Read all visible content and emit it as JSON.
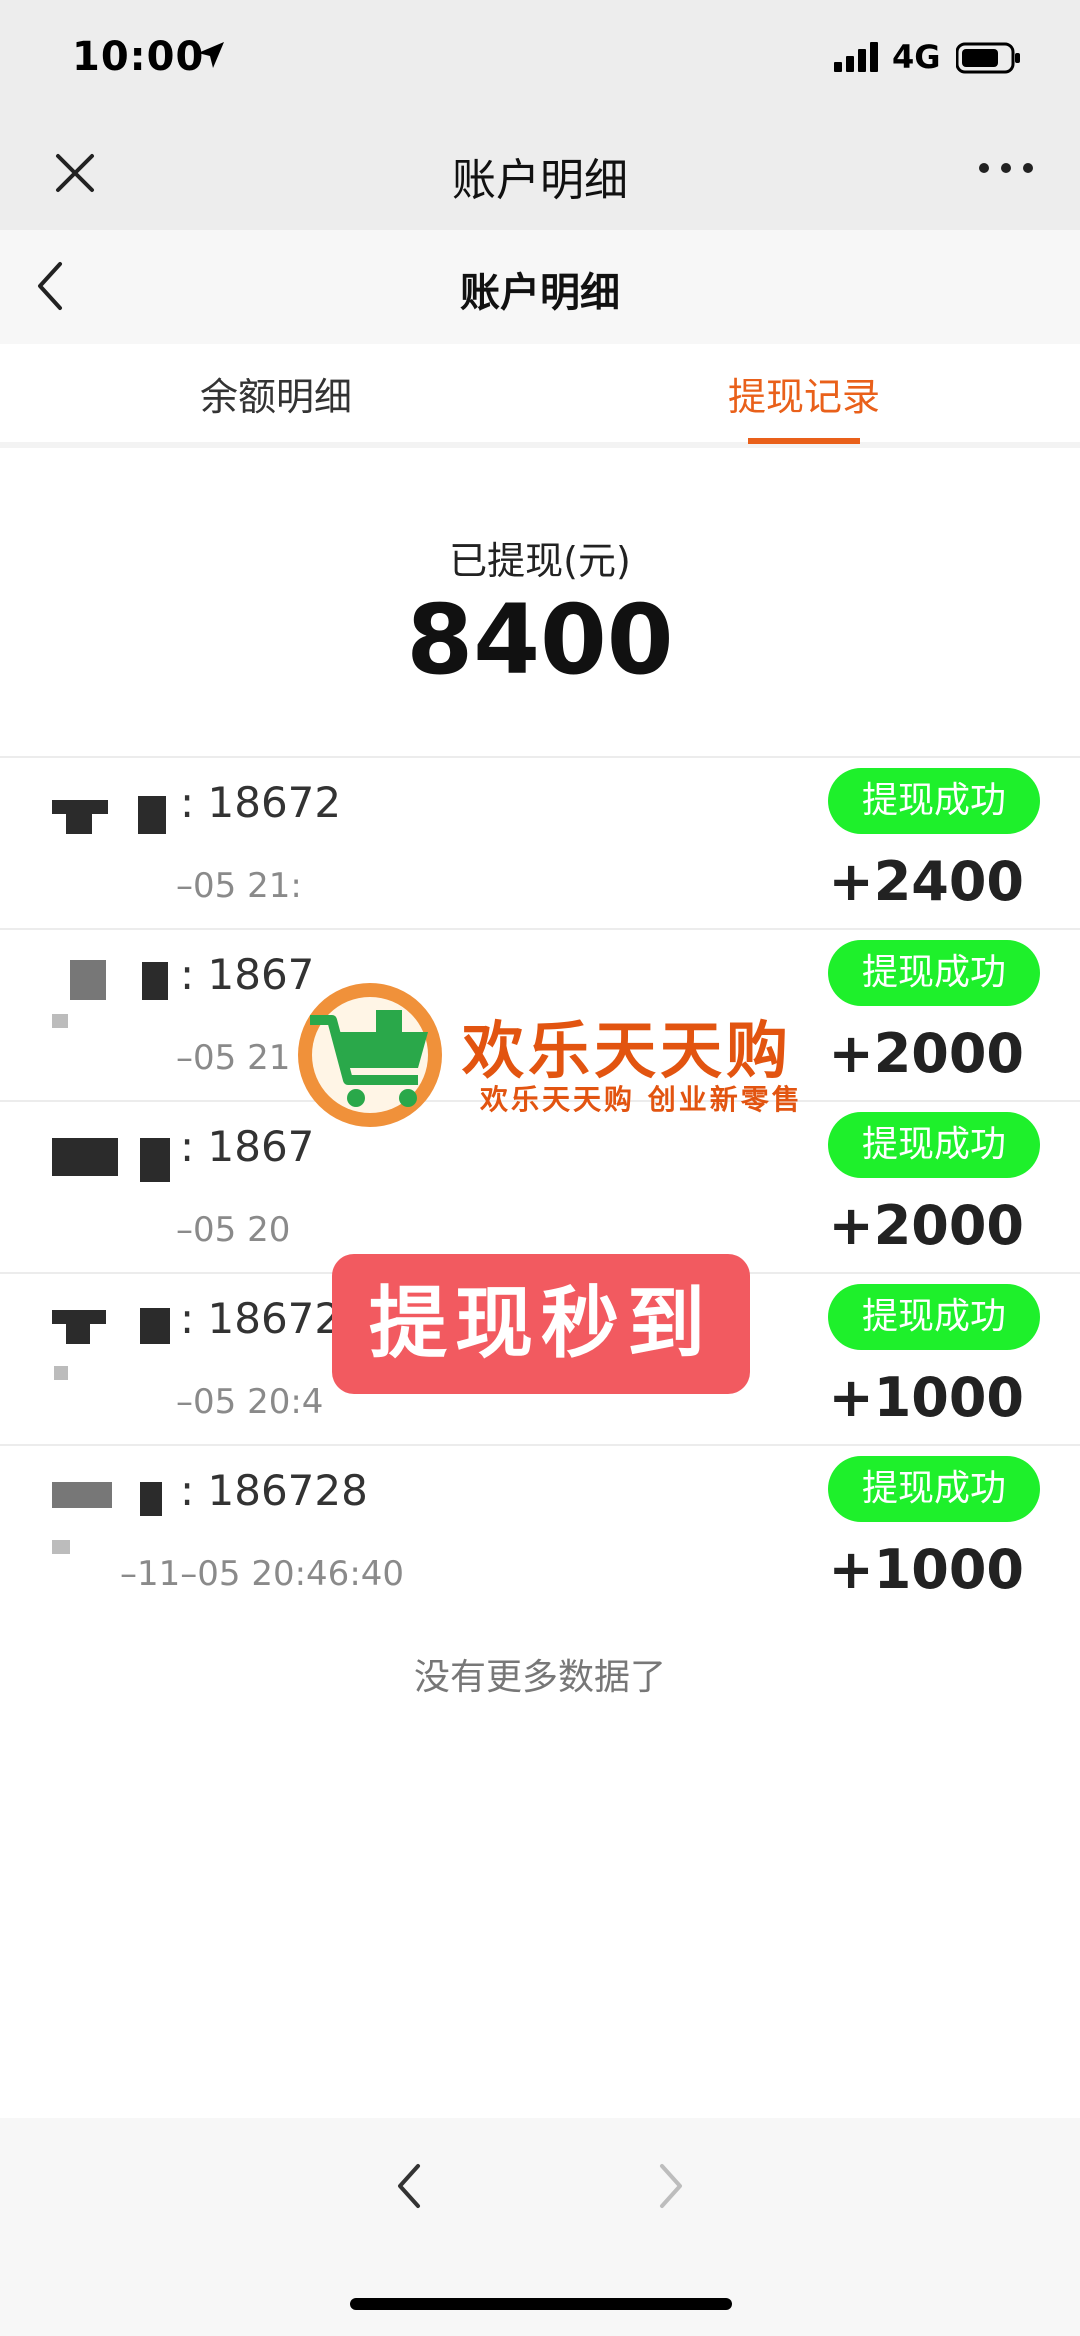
{
  "status_bar": {
    "time": "10:00",
    "network": "4G",
    "icons": [
      "location-arrow-icon",
      "signal-icon",
      "battery-icon"
    ]
  },
  "navbar": {
    "title": "账户明细",
    "close_icon": "close-icon",
    "more_icon": "more-icon"
  },
  "page_header": {
    "title": "账户明细",
    "back_icon": "chevron-left-icon"
  },
  "tabs": [
    {
      "label": "余额明细",
      "active": false
    },
    {
      "label": "提现记录",
      "active": true
    }
  ],
  "accent_color": "#e9601a",
  "success_color": "#1ef02b",
  "summary": {
    "label": "已提现(元)",
    "amount": "8400"
  },
  "records": [
    {
      "phone": ": 18672",
      "time": "–05 21:",
      "status": "提现成功",
      "amount": "+2400"
    },
    {
      "phone": ": 1867",
      "time": "–05 21",
      "status": "提现成功",
      "amount": "+2000"
    },
    {
      "phone": ": 1867",
      "time": "–05 20",
      "status": "提现成功",
      "amount": "+2000"
    },
    {
      "phone": ": 18672",
      "time": "–05 20:4",
      "status": "提现成功",
      "amount": "+1000"
    },
    {
      "phone": ": 186728",
      "time": "–11–05 20:46:40",
      "status": "提现成功",
      "amount": "+1000"
    }
  ],
  "footer_text": "没有更多数据了",
  "watermark": {
    "title": "欢乐天天购",
    "subtitle": "欢乐天天购 创业新零售",
    "logo_icon": "shopping-cart-icon"
  },
  "promo": {
    "text": "提现秒到"
  },
  "bottom_bar": {
    "back_icon": "chevron-left-icon",
    "forward_icon": "chevron-right-icon"
  }
}
